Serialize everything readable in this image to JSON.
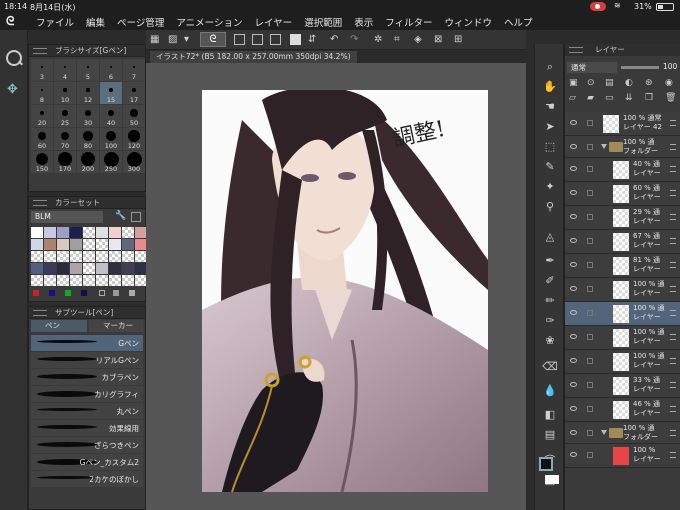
{
  "status": {
    "time": "18:14",
    "date": "8月14日(水)",
    "battery": "31%"
  },
  "menu": [
    "ファイル",
    "編集",
    "ページ管理",
    "アニメーション",
    "レイヤー",
    "選択範囲",
    "表示",
    "フィルター",
    "ウィンドウ",
    "ヘルプ"
  ],
  "panels": {
    "brush_size": {
      "title": "ブラシサイズ[Gペン]",
      "sizes": [
        "3",
        "4",
        "5",
        "6",
        "7",
        "8",
        "10",
        "12",
        "15",
        "17",
        "20",
        "25",
        "30",
        "40",
        "50",
        "60",
        "70",
        "80",
        "100",
        "120",
        "150",
        "170",
        "200",
        "250",
        "300"
      ],
      "selected": "15"
    },
    "color_set": {
      "title": "カラーセット",
      "set_name": "BLM",
      "colors": [
        "#ffffff",
        "#c8c8e0",
        "#9aa0c8",
        "#1b1f4a",
        "#t",
        "#e0e0e0",
        "#f0d0d0",
        "#t",
        "#d4a0a0",
        "#d0d8e8",
        "#b08070",
        "#d8c8c0",
        "#a0a0a0",
        "#t",
        "#t",
        "#e8e8f0",
        "#606880",
        "#e88a8a",
        "#t",
        "#t",
        "#t",
        "#t",
        "#t",
        "#t",
        "#t",
        "#t",
        "#t",
        "#506080",
        "#3a3a5a",
        "#2a2a3a",
        "#b0a0a8",
        "#t",
        "#c0c0c8",
        "#303040",
        "#404050",
        "#2a3048",
        "#t",
        "#t",
        "#t",
        "#t",
        "#t",
        "#t",
        "#t",
        "#t",
        "#t"
      ]
    },
    "sub_tool": {
      "title": "サブツール[ペン]",
      "tabs": [
        "ペン",
        "マーカー"
      ],
      "items": [
        "Gペン",
        "リアルGペン",
        "カブラペン",
        "カリグラフィ",
        "丸ペン",
        "効果線用",
        "ざらつきペン",
        "Gペン_カスタム2",
        "2カケのぼかし"
      ],
      "selected": "Gペン"
    }
  },
  "document": {
    "tab_label": "イラスト72* (B5 182.00 x 257.00mm 350dpi 34.2%)",
    "annotation": "調整!"
  },
  "layers": {
    "panel_title": "レイヤー",
    "blend_mode": "通常",
    "opacity": "100",
    "list": [
      {
        "line1": "100 % 通常",
        "line2": "レイヤー 42",
        "type": "layer",
        "indent": 0
      },
      {
        "line1": "100 % 通",
        "line2": "フォルダー",
        "type": "folder",
        "indent": 0
      },
      {
        "line1": "40 % 通",
        "line2": "レイヤー",
        "type": "layer",
        "indent": 1
      },
      {
        "line1": "60 % 通",
        "line2": "レイヤー",
        "type": "layer",
        "indent": 1
      },
      {
        "line1": "29 % 通",
        "line2": "レイヤー",
        "type": "layer",
        "indent": 1
      },
      {
        "line1": "67 % 通",
        "line2": "レイヤー",
        "type": "layer",
        "indent": 1
      },
      {
        "line1": "81 % 通",
        "line2": "レイヤー",
        "type": "layer",
        "indent": 1
      },
      {
        "line1": "100 % 通",
        "line2": "レイヤー",
        "type": "layer",
        "indent": 1
      },
      {
        "line1": "100 % 通",
        "line2": "レイヤー",
        "type": "layer",
        "indent": 1,
        "selected": true
      },
      {
        "line1": "100 % 通",
        "line2": "レイヤー",
        "type": "layer",
        "indent": 1
      },
      {
        "line1": "100 % 通",
        "line2": "レイヤー",
        "type": "layer",
        "indent": 1
      },
      {
        "line1": "33 % 通",
        "line2": "レイヤー",
        "type": "layer",
        "indent": 1
      },
      {
        "line1": "46 % 通",
        "line2": "レイヤー",
        "type": "layer",
        "indent": 1
      },
      {
        "line1": "100 % 通",
        "line2": "フォルダー",
        "type": "folder",
        "indent": 0
      },
      {
        "line1": "100 %",
        "line2": "レイヤー",
        "type": "layer",
        "indent": 1,
        "thumb": "red"
      }
    ]
  }
}
